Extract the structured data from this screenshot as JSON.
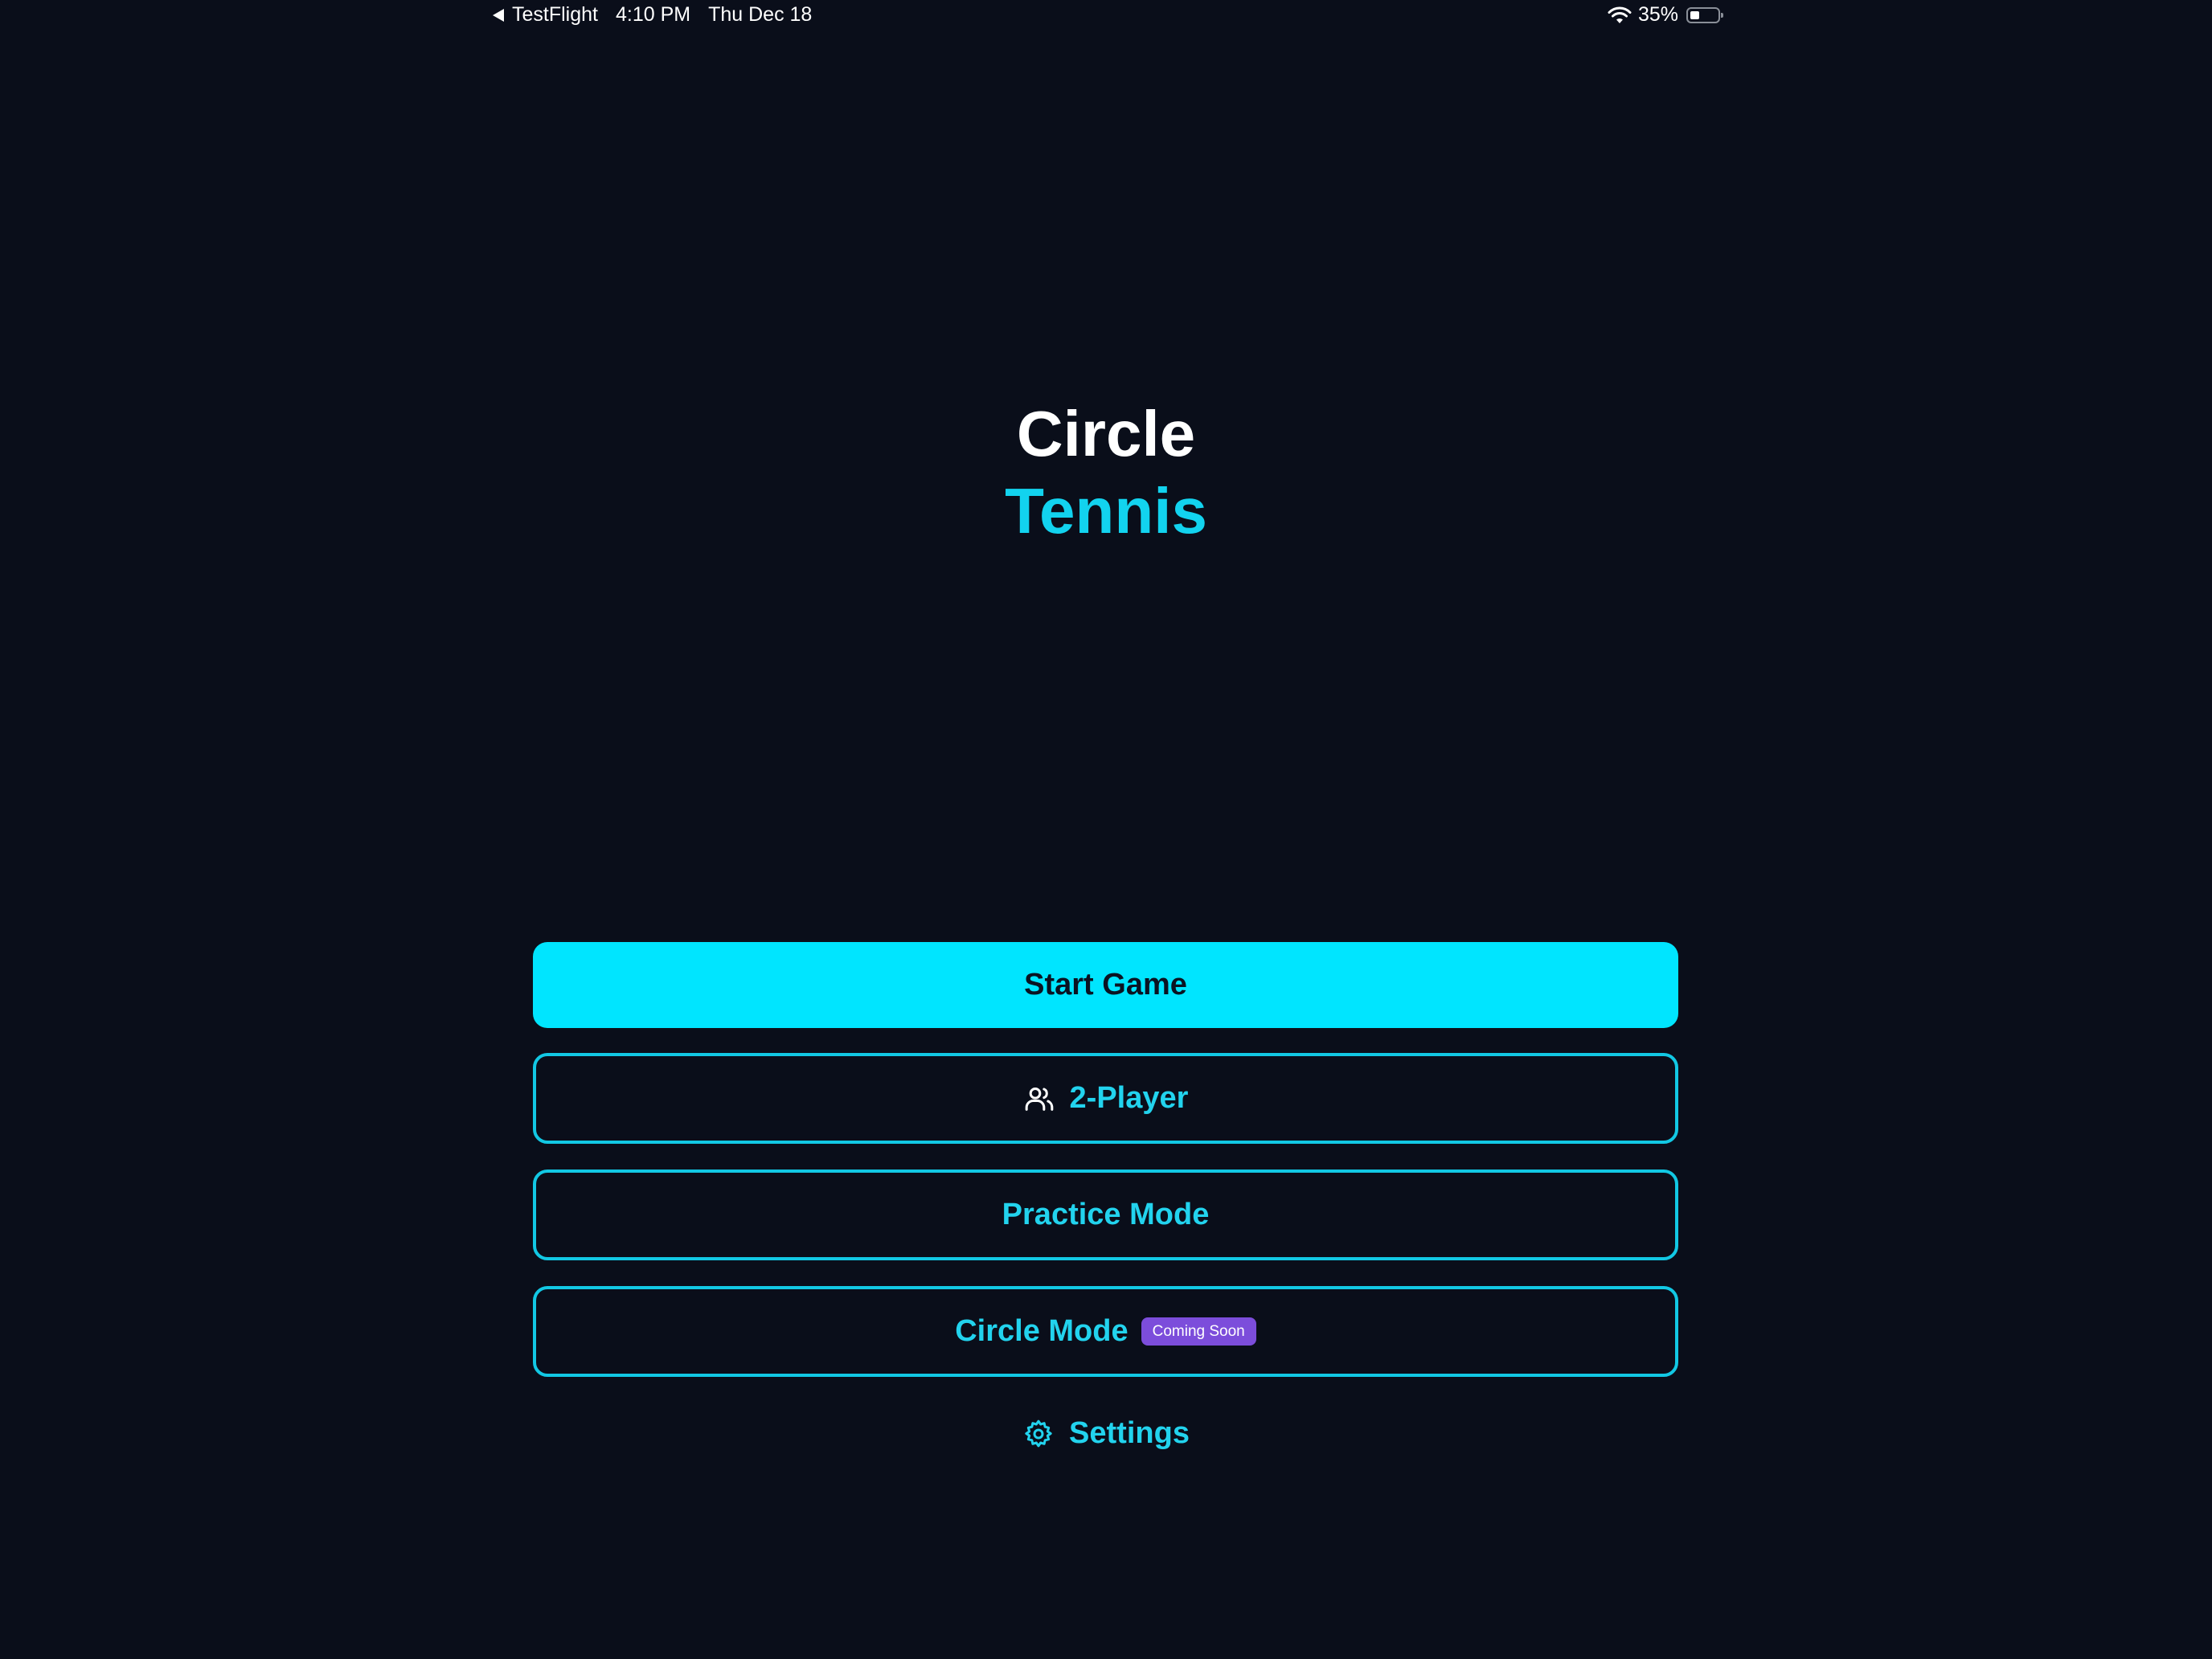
{
  "status_bar": {
    "back_app": "TestFlight",
    "time": "4:10 PM",
    "date": "Thu Dec 18",
    "battery_percent": "35%",
    "battery_level": 0.35
  },
  "title": {
    "line1": "Circle",
    "line2": "Tennis"
  },
  "menu": {
    "start_game": "Start Game",
    "two_player": "2-Player",
    "practice_mode": "Practice Mode",
    "circle_mode": "Circle Mode",
    "circle_mode_badge": "Coming Soon",
    "settings": "Settings"
  },
  "icons": {
    "two_player": "users-icon",
    "settings": "gear-icon",
    "wifi": "wifi-icon",
    "battery": "battery-icon",
    "back": "back-arrow-icon"
  },
  "colors": {
    "background": "#0a0e1a",
    "accent": "#00e5ff",
    "badge": "#7c4ddb"
  }
}
